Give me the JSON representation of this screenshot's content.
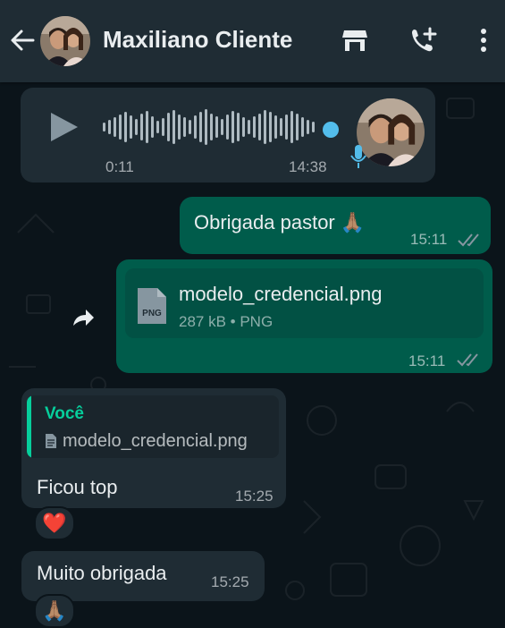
{
  "header": {
    "contact_name": "Maxiliano Cliente",
    "icons": [
      "back-arrow-icon",
      "avatar",
      "store-icon",
      "add-call-icon",
      "more-menu-icon"
    ]
  },
  "messages": {
    "audio": {
      "position": "0:11",
      "time": "14:38"
    },
    "thanks": {
      "text": "Obrigada pastor 🙏🏽",
      "time": "15:11"
    },
    "document": {
      "icon_label": "PNG",
      "file_name": "modelo_credencial.png",
      "meta": "287 kB • PNG",
      "time": "15:11"
    },
    "reply": {
      "quote_author": "Você",
      "quote_text": "modelo_credencial.png",
      "text": "Ficou top",
      "time": "15:25",
      "reaction": "❤️"
    },
    "last": {
      "text": "Muito obrigada",
      "time": "15:25",
      "reaction": "🙏🏽"
    }
  },
  "colors": {
    "background": "#0b141a",
    "header": "#1f2c34",
    "incoming": "#1f2c34",
    "outgoing": "#005c4b",
    "accent": "#06cf9c",
    "audio_dot": "#53bdeb"
  }
}
